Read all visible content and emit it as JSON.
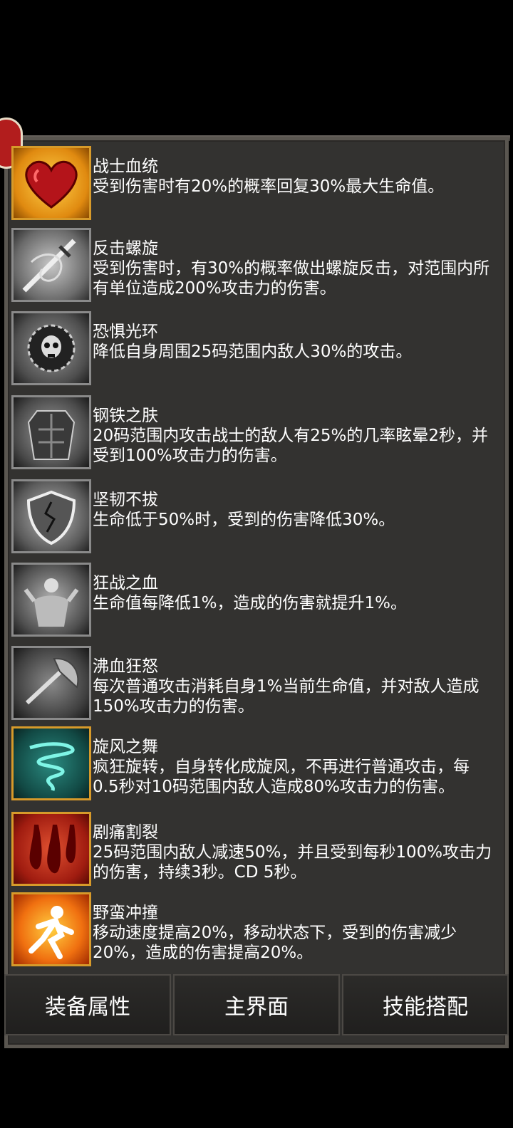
{
  "skills": [
    {
      "title": "战士血统",
      "desc": "受到伤害时有20%的概率回复30%最大生命值。",
      "icon": "heart-icon"
    },
    {
      "title": "反击螺旋",
      "desc": "受到伤害时，有30%的概率做出螺旋反击，对范围内所有单位造成200%攻击力的伤害。",
      "icon": "spiral-sword-icon"
    },
    {
      "title": "恐惧光环",
      "desc": "降低自身周围25码范围内敌人30%的攻击。",
      "icon": "skull-aura-icon"
    },
    {
      "title": "钢铁之肤",
      "desc": "20码范围内攻击战士的敌人有25%的几率眩晕2秒，并受到100%攻击力的伤害。",
      "icon": "armored-torso-icon"
    },
    {
      "title": "坚韧不拔",
      "desc": "生命低于50%时，受到的伤害降低30%。",
      "icon": "cracked-shield-icon"
    },
    {
      "title": "狂战之血",
      "desc": "生命值每降低1%，造成的伤害就提升1%。",
      "icon": "berserker-icon"
    },
    {
      "title": "沸血狂怒",
      "desc": "每次普通攻击消耗自身1%当前生命值，并对敌人造成150%攻击力的伤害。",
      "icon": "axe-icon"
    },
    {
      "title": "旋风之舞",
      "desc": "疯狂旋转，自身转化成旋风，不再进行普通攻击，每0.5秒对10码范围内敌人造成80%攻击力的伤害。",
      "icon": "whirlwind-icon"
    },
    {
      "title": "剧痛割裂",
      "desc": "25码范围内敌人减速50%，并且受到每秒100%攻击力的伤害，持续3秒。CD 5秒。",
      "icon": "blood-drops-icon"
    },
    {
      "title": "野蛮冲撞",
      "desc": "移动速度提高20%，移动状态下，受到的伤害减少20%，造成的伤害提高20%。",
      "icon": "charging-man-icon"
    }
  ],
  "tabs": {
    "equipment": "装备属性",
    "main": "主界面",
    "skills": "技能搭配"
  },
  "colors": {
    "panel_bg": "#333230",
    "text": "#ffffff",
    "badge": "#b21d1d"
  }
}
